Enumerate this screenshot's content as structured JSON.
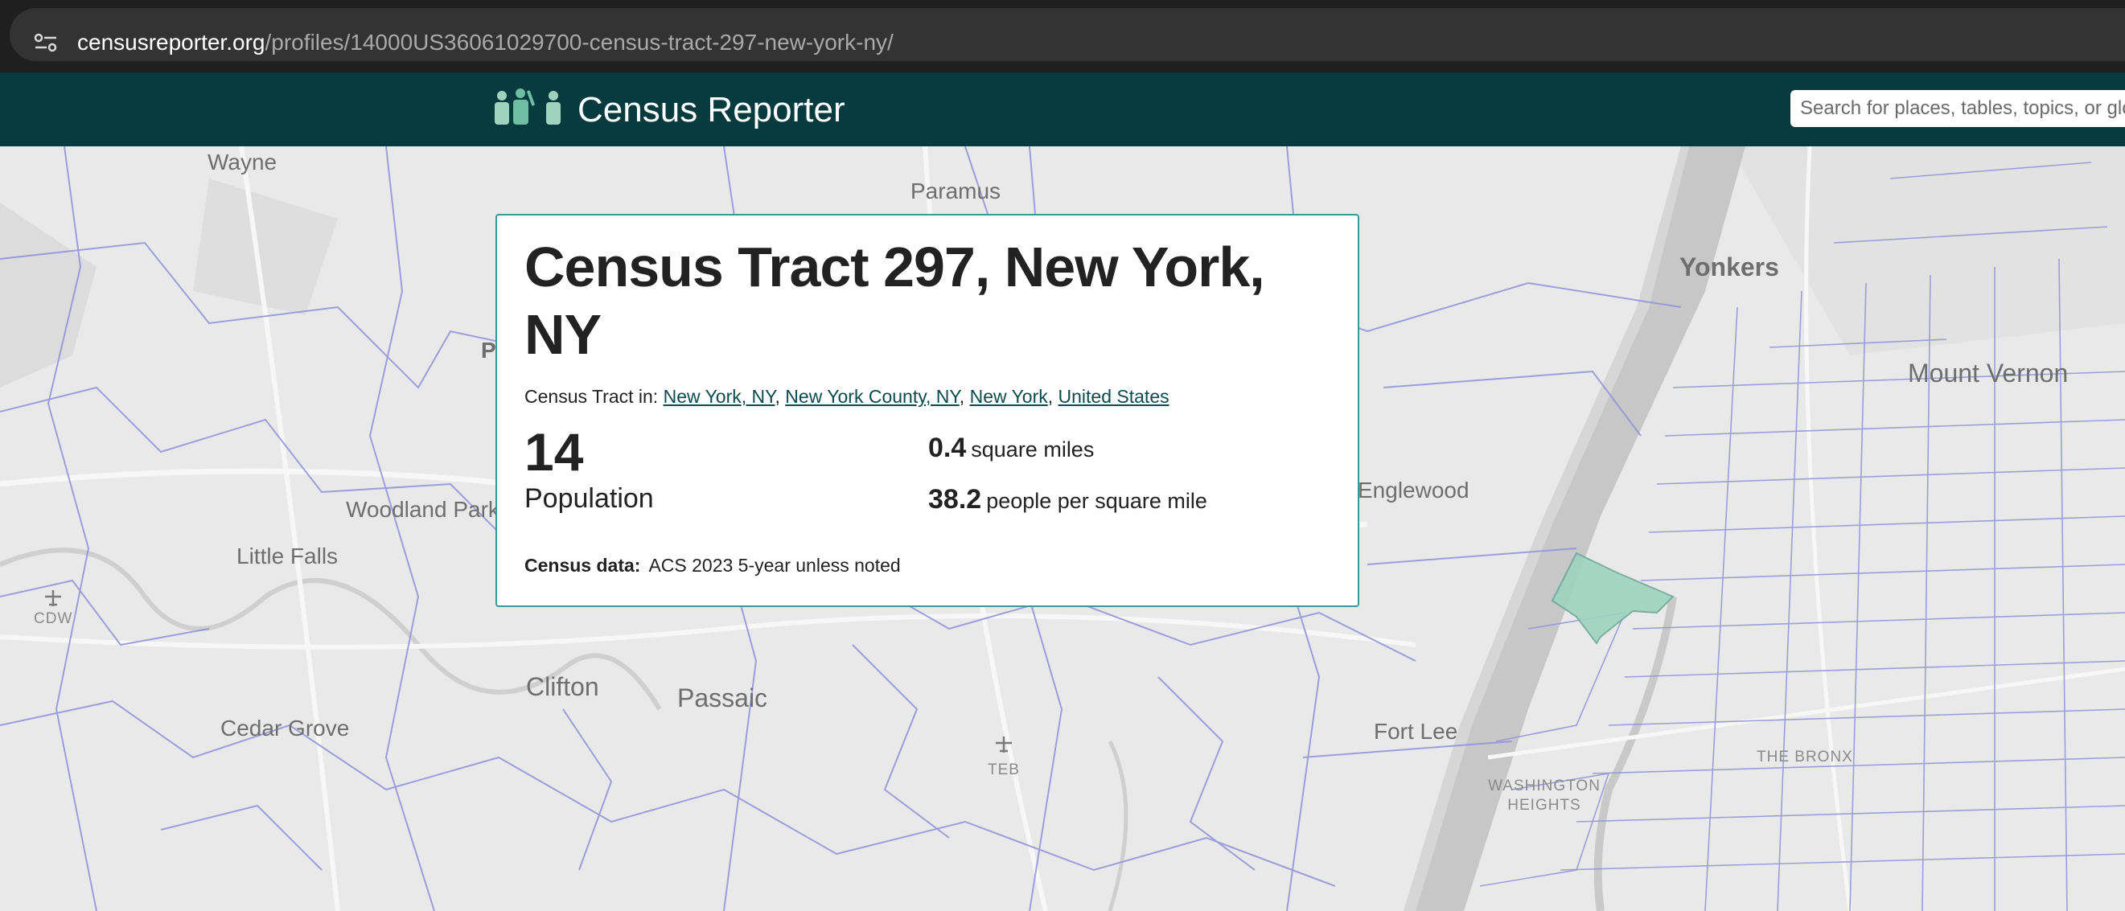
{
  "browser": {
    "url_host": "censusreporter.org",
    "url_path": "/profiles/14000US36061029700-census-tract-297-new-york-ny/",
    "site_info_icon": "tune-icon"
  },
  "header": {
    "logo_text": "Census Reporter",
    "logo_icon": "people-icon",
    "search_placeholder": "Search for places, tables, topics, or glossary terms",
    "background_color": "#073b3e"
  },
  "profile": {
    "title": "Census Tract 297, New York, NY",
    "parents_prefix": "Census Tract in:",
    "parents": [
      "New York, NY",
      "New York County, NY",
      "New York",
      "United States"
    ],
    "population_value": "14",
    "population_label": "Population",
    "area_value": "0.4",
    "area_unit": "square miles",
    "density_value": "38.2",
    "density_unit": "people per square mile",
    "data_label": "Census data:",
    "data_source": "ACS 2023 5-year unless noted"
  },
  "map": {
    "labels": [
      {
        "text": "Wayne"
      },
      {
        "text": "Paramus"
      },
      {
        "text": "Yonkers"
      },
      {
        "text": "Mount Vernon"
      },
      {
        "text": "P"
      },
      {
        "text": "Woodland Park"
      },
      {
        "text": "Little Falls"
      },
      {
        "text": "CDW"
      },
      {
        "text": "Englewood"
      },
      {
        "text": "Clifton"
      },
      {
        "text": "Passaic"
      },
      {
        "text": "Cedar Grove"
      },
      {
        "text": "TEB"
      },
      {
        "text": "Fort Lee"
      },
      {
        "text": "THE BRONX"
      },
      {
        "text": "WASHINGTON HEIGHTS"
      }
    ],
    "highlight_color": "#9fd3c0",
    "boundary_color": "#8a8ad6"
  }
}
